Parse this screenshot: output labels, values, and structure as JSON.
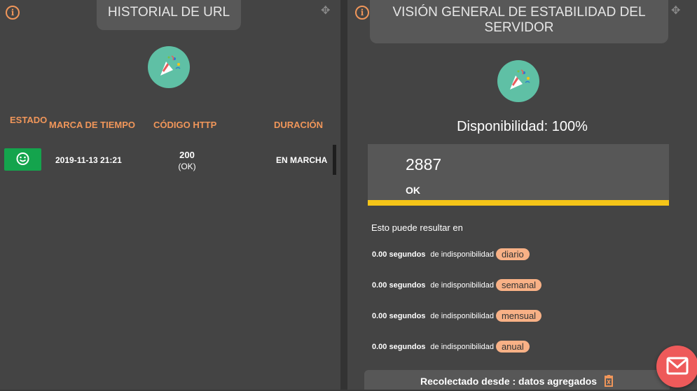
{
  "left_panel": {
    "title": "HISTORIAL DE URL",
    "columns": {
      "status": "ESTADO",
      "timestamp": "MARCA DE TIEMPO",
      "http_code": "CÓDIGO HTTP",
      "duration": "DURACIÓN"
    },
    "rows": [
      {
        "status_icon": "smile-icon",
        "timestamp": "2019-11-13 21:21",
        "http_code": "200",
        "http_text": "(OK)",
        "duration": "EN MARCHA"
      }
    ]
  },
  "right_panel": {
    "title": "VISIÓN GENERAL DE ESTABILIDAD DEL SERVIDOR",
    "availability": "Disponibilidad: 100%",
    "stat_value": "2887",
    "stat_label": "OK",
    "intro": "Esto puede resultar en",
    "downtime": [
      {
        "seconds": "0.00 segundos",
        "label": "de indisponibilidad",
        "period": "diario"
      },
      {
        "seconds": "0.00 segundos",
        "label": "de indisponibilidad",
        "period": "semanal"
      },
      {
        "seconds": "0.00 segundos",
        "label": "de indisponibilidad",
        "period": "mensual"
      },
      {
        "seconds": "0.00 segundos",
        "label": "de indisponibilidad",
        "period": "anual"
      }
    ],
    "footer": "Recolectado desde : datos agregados"
  },
  "colors": {
    "accent": "#f0965a",
    "status_ok": "#14a44d",
    "bar": "#f5c518",
    "avatar": "#5fc0a5",
    "mail": "#ee5a5a"
  },
  "icons": [
    "info-icon",
    "move-icon",
    "party-popper-icon",
    "smile-icon",
    "trash-icon",
    "mail-icon"
  ]
}
